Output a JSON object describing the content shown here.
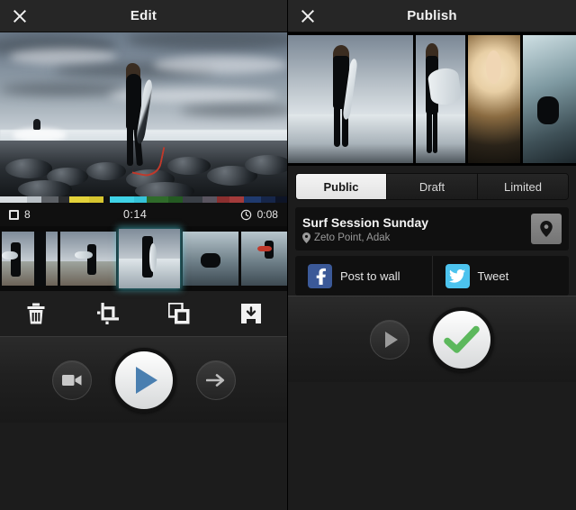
{
  "screens": {
    "edit": {
      "header": {
        "title": "Edit",
        "close_icon": "close-icon"
      },
      "timeline_info": {
        "clip_count_icon": "square-icon",
        "clip_count": "8",
        "total_duration": "0:14",
        "clock_icon": "clock-icon",
        "clip_duration": "0:08"
      },
      "segments_colors": [
        "#d8dde1",
        "#b9c0c6",
        "#5d6166",
        "#2b2d2f",
        "#e3d23a",
        "#d6c52f",
        "#0f1112",
        "#3fd2e6",
        "#35c3d8",
        "#2f6b2a",
        "#245a22",
        "#3a3f46",
        "#5a5560",
        "#8b2f2f",
        "#a33b3b",
        "#1f3a6e",
        "#16264a",
        "#0d1426"
      ],
      "thumbnails": [
        {
          "label": "clip-1",
          "selected": false
        },
        {
          "label": "clip-2",
          "selected": false
        },
        {
          "label": "clip-3",
          "selected": true
        },
        {
          "label": "clip-4",
          "selected": false
        },
        {
          "label": "clip-5",
          "selected": false
        }
      ],
      "tools": [
        {
          "name": "delete-button",
          "icon": "trash-icon"
        },
        {
          "name": "crop-button",
          "icon": "crop-icon"
        },
        {
          "name": "duplicate-button",
          "icon": "duplicate-icon"
        },
        {
          "name": "save-button",
          "icon": "save-icon"
        }
      ],
      "controls": {
        "camera": {
          "name": "camera-button",
          "icon": "video-camera-icon"
        },
        "play": {
          "name": "play-button",
          "icon": "play-icon",
          "color": "#4a7fb0"
        },
        "next": {
          "name": "next-button",
          "icon": "arrow-right-icon"
        }
      }
    },
    "publish": {
      "header": {
        "title": "Publish",
        "close_icon": "close-icon"
      },
      "tabs": [
        {
          "label": "Public",
          "active": true
        },
        {
          "label": "Draft",
          "active": false
        },
        {
          "label": "Limited",
          "active": false
        }
      ],
      "video": {
        "title": "Surf Session Sunday",
        "location": "Zeto Point, Adak",
        "location_icon": "map-pin-icon",
        "location_button_icon": "map-pin-icon"
      },
      "share": [
        {
          "label": "Post to wall",
          "icon": "facebook-icon",
          "color": "#3b5998",
          "glyph": "f"
        },
        {
          "label": "Tweet",
          "icon": "twitter-icon",
          "color": "#4cc3ee",
          "glyph": "t"
        }
      ],
      "controls": {
        "play": {
          "name": "play-button",
          "icon": "play-icon"
        },
        "confirm": {
          "name": "confirm-button",
          "icon": "check-icon",
          "color": "#5cb85c"
        }
      }
    }
  }
}
